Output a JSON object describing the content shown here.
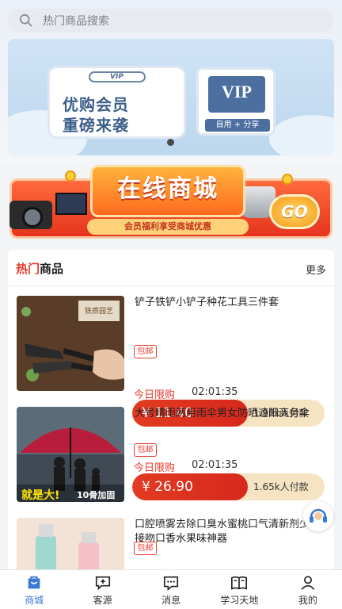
{
  "search": {
    "placeholder": "热门商品搜索"
  },
  "banner": {
    "vip_small": "VIP",
    "line1": "优购会员",
    "line2": "重磅来袭",
    "vip_box": "VIP",
    "vip_tag": "自用 + 分享"
  },
  "promo": {
    "title": "在线商城",
    "subtitle": "会员福利享受商城优惠",
    "go": "GO"
  },
  "hot": {
    "title_red": "热门",
    "title_rest": "商品",
    "more": "更多"
  },
  "products": [
    {
      "name": "铲子铁铲小铲子种花工具三件套",
      "badge": "包邮",
      "flash_label": "今日限购",
      "timer": "02:01:35",
      "price": "¥ 11.40",
      "sold": "1.98k人付款",
      "thumb_text": "铁质园艺"
    },
    {
      "name": "大号晴雨两用雨伞男女防晒遮阳商务伞",
      "badge": "包邮",
      "flash_label": "今日限购",
      "timer": "02:01:35",
      "price": "¥ 26.90",
      "sold": "1.65k人付款",
      "thumb_text": "就是大!",
      "thumb_text2": "10骨加固"
    },
    {
      "name": "口腔喷雾去除口臭水蜜桃口气清新剂少女接吻口香水果味神器",
      "badge": "包邮"
    }
  ],
  "tabs": [
    {
      "label": "商城",
      "icon": "shop-icon",
      "active": true
    },
    {
      "label": "客源",
      "icon": "chat-plus-icon",
      "active": false
    },
    {
      "label": "消息",
      "icon": "message-icon",
      "active": false
    },
    {
      "label": "学习天地",
      "icon": "book-icon",
      "active": false
    },
    {
      "label": "我的",
      "icon": "user-icon",
      "active": false
    }
  ],
  "colors": {
    "accent": "#3a79d6",
    "price_red": "#e23b22",
    "hot_red": "#e63a2a"
  }
}
